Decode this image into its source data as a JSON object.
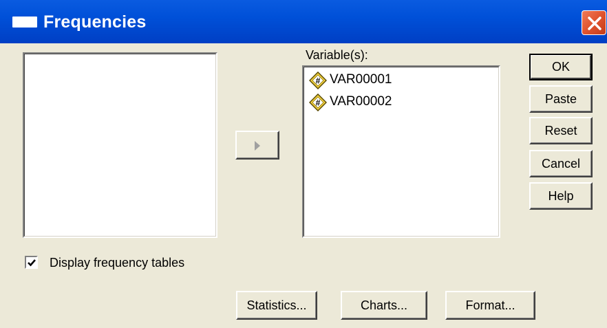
{
  "window": {
    "title": "Frequencies",
    "accent": "#0050d8",
    "close_color": "#e0542e"
  },
  "variables_label": "Variable(s):",
  "source_items": [],
  "target_items": [
    {
      "label": "VAR00001",
      "icon": "numeric-variable-icon"
    },
    {
      "label": "VAR00002",
      "icon": "numeric-variable-icon"
    }
  ],
  "buttons": {
    "ok": "OK",
    "paste": "Paste",
    "reset": "Reset",
    "cancel": "Cancel",
    "help": "Help",
    "statistics": "Statistics...",
    "charts": "Charts...",
    "format": "Format..."
  },
  "move_button_icon": "right-arrow-icon",
  "display_frequency_tables": {
    "label": "Display frequency tables",
    "checked": true
  }
}
